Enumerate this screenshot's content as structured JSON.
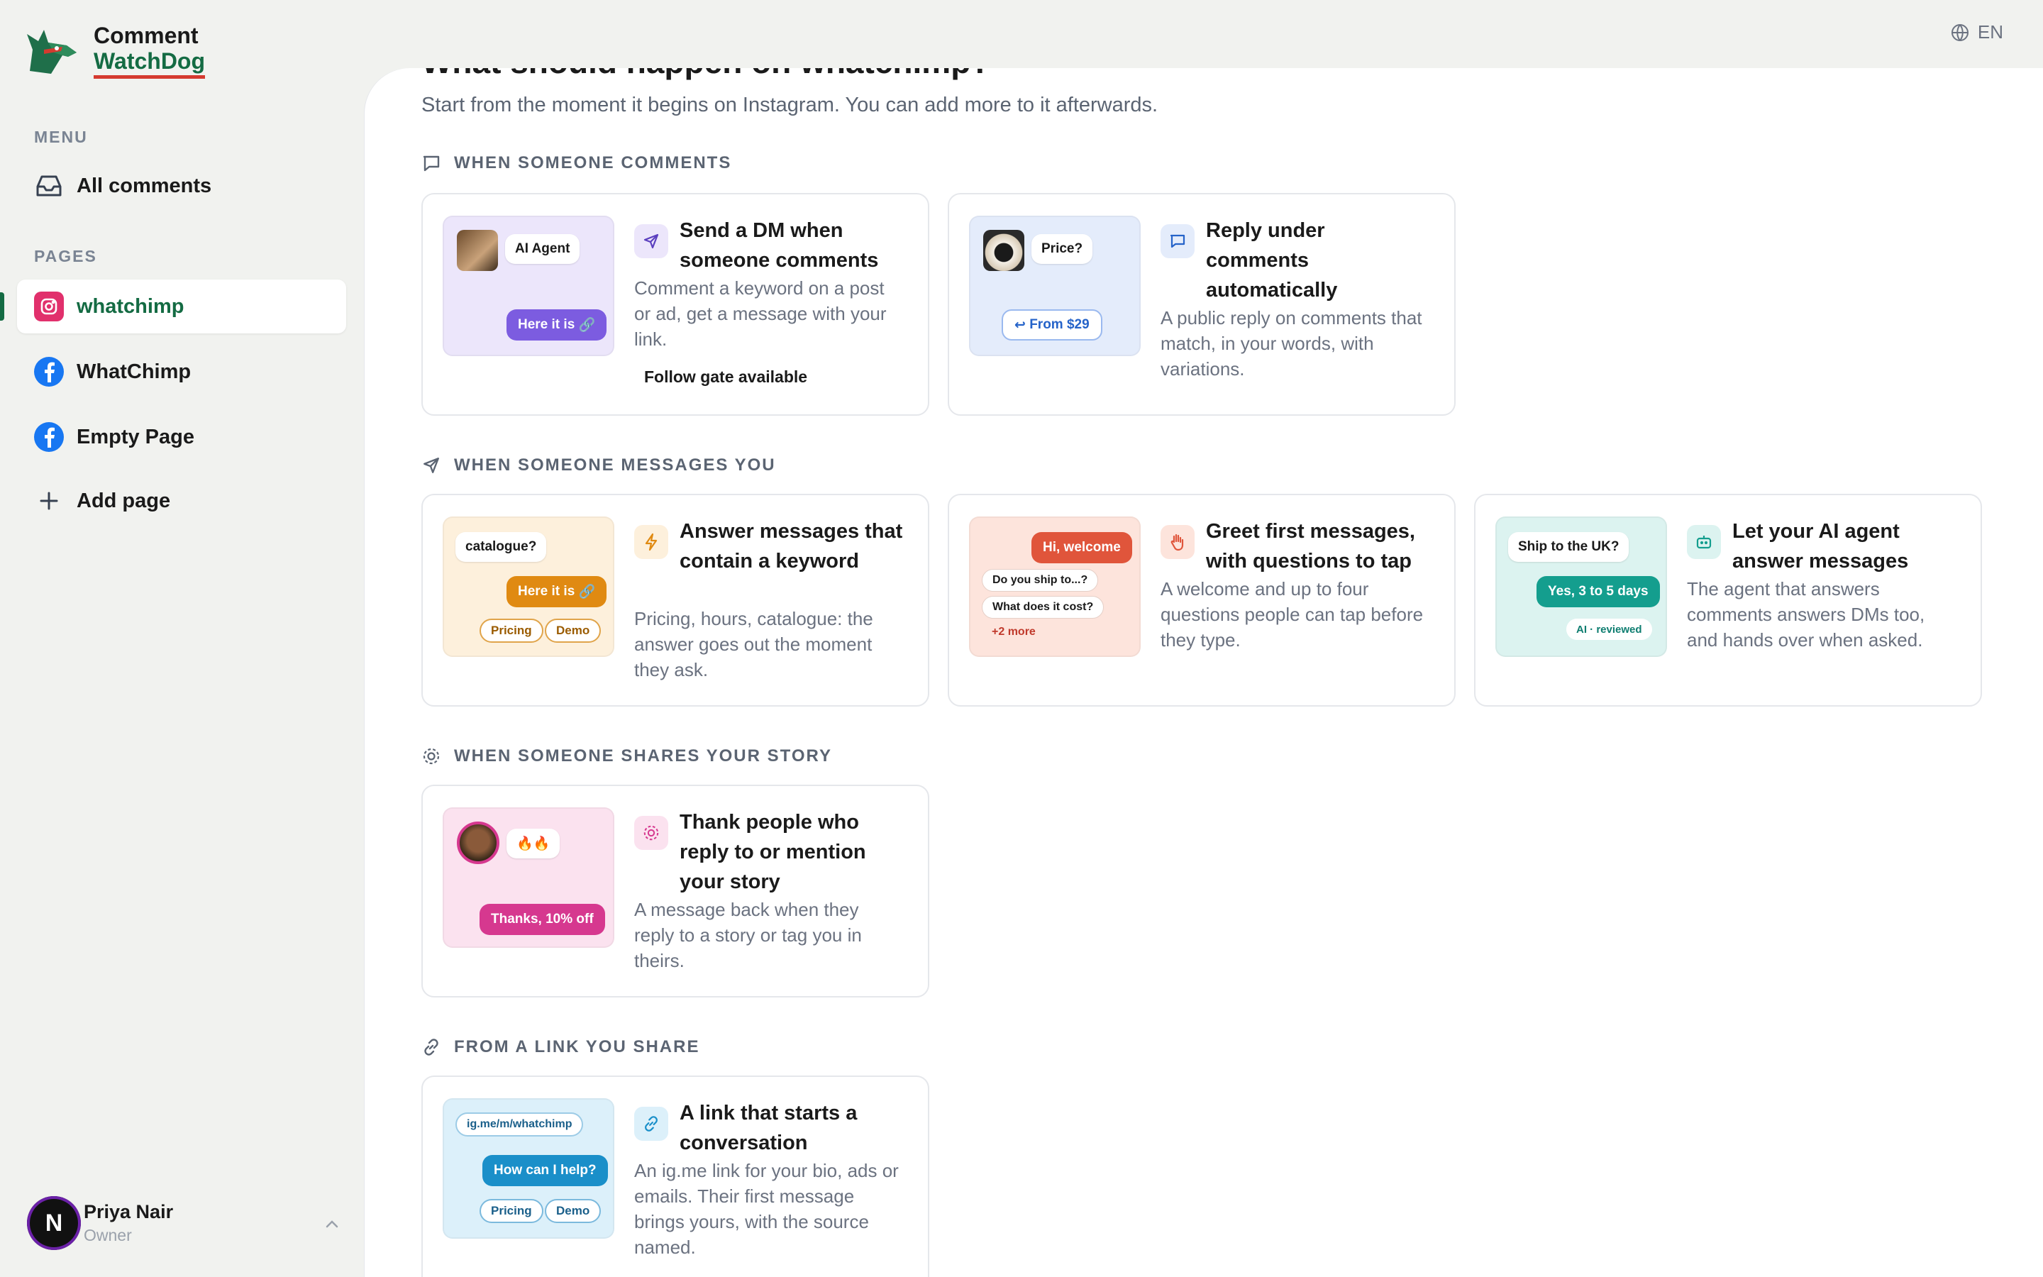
{
  "brand": {
    "line1": "Comment",
    "line2": "WatchDog"
  },
  "language": "EN",
  "sidebar": {
    "menu_label": "MENU",
    "pages_label": "PAGES",
    "all_comments": "All comments",
    "pages": [
      {
        "label": "whatchimp",
        "platform": "instagram",
        "active": true
      },
      {
        "label": "WhatChimp",
        "platform": "facebook",
        "active": false
      },
      {
        "label": "Empty Page",
        "platform": "facebook",
        "active": false
      }
    ],
    "add_page": "Add page"
  },
  "user": {
    "initial": "N",
    "name": "Priya Nair",
    "role": "Owner"
  },
  "main": {
    "title": "What should happen on whatchimp?",
    "subtitle": "Start from the moment it begins on Instagram. You can add more to it afterwards.",
    "groups": [
      {
        "heading": "WHEN SOMEONE COMMENTS",
        "cards": [
          {
            "title": "Send a DM when someone comments",
            "desc": "Comment a keyword on a post or ad, get a message with your link.",
            "foot": "Follow gate available",
            "thumb": {
              "bubble": "AI Agent",
              "pill": "Here it is"
            }
          },
          {
            "title": "Reply under comments automatically",
            "desc": "A public reply on comments that match, in your words, with variations.",
            "thumb": {
              "bubble": "Price?",
              "pill": "From $29"
            }
          }
        ]
      },
      {
        "heading": "WHEN SOMEONE MESSAGES YOU",
        "cards": [
          {
            "title": "Answer messages that contain a keyword",
            "desc": "Pricing, hours, catalogue: the answer goes out the moment they ask.",
            "thumb": {
              "bubble": "catalogue?",
              "pill": "Here it is",
              "chip1": "Pricing",
              "chip2": "Demo"
            }
          },
          {
            "title": "Greet first messages, with questions to tap",
            "desc": "A welcome and up to four questions people can tap before they type.",
            "thumb": {
              "pill": "Hi, welcome",
              "chip1": "Do you ship to...?",
              "chip2": "What does it cost?",
              "more": "+2 more"
            }
          },
          {
            "title": "Let your AI agent answer messages",
            "desc": "The agent that answers comments answers DMs too, and hands over when asked.",
            "thumb": {
              "bubble": "Ship to the UK?",
              "pill": "Yes, 3 to 5 days",
              "chip1": "AI · reviewed"
            }
          }
        ]
      },
      {
        "heading": "WHEN SOMEONE SHARES YOUR STORY",
        "cards": [
          {
            "title": "Thank people who reply to or mention your story",
            "desc": "A message back when they reply to a story or tag you in theirs.",
            "thumb": {
              "bubble": "🔥🔥",
              "pill": "Thanks, 10% off"
            }
          }
        ]
      },
      {
        "heading": "FROM A LINK YOU SHARE",
        "cards": [
          {
            "title": "A link that starts a conversation",
            "desc": "An ig.me link for your bio, ads or emails. Their first message brings yours, with the source named.",
            "thumb": {
              "chip0": "ig.me/m/whatchimp",
              "pill": "How can I help?",
              "chip1": "Pricing",
              "chip2": "Demo"
            }
          }
        ]
      }
    ]
  },
  "colors": {
    "brand_green": "#146b43",
    "instagram": "#e1306c",
    "facebook": "#1877f2",
    "purple": "#7c5ce0",
    "orange": "#e08a12",
    "red": "#e0553b",
    "teal": "#149e8e",
    "pink": "#d6388f",
    "blue": "#1a8fc9"
  }
}
